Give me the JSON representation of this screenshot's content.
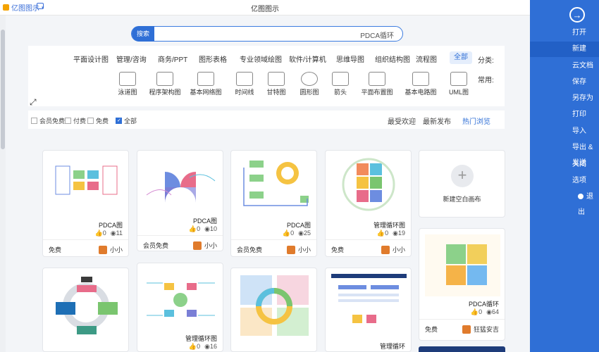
{
  "titlebar": {
    "app_name": "亿图图示",
    "window_title": "亿图图示"
  },
  "nav": {
    "items": [
      {
        "label": "打开"
      },
      {
        "label": "新建"
      },
      {
        "label": "云文档"
      },
      {
        "label": "保存"
      },
      {
        "label": "另存为"
      },
      {
        "label": "打印"
      },
      {
        "label": "导入"
      },
      {
        "label": "导出 & 发送"
      },
      {
        "label": "关闭"
      },
      {
        "label": "选项"
      },
      {
        "label": "退出"
      }
    ]
  },
  "search": {
    "button": "搜索",
    "value": "PDCA循环"
  },
  "categories": {
    "label": "分类:",
    "items": [
      "全部",
      "流程图",
      "组织结构图",
      "思维导图",
      "软件/计算机",
      "专业领域绘图",
      "图形表格",
      "商务/PPT",
      "管理/咨询",
      "平面设计图"
    ],
    "common_label": "常用:",
    "common": [
      "UML图",
      "基本电路图",
      "平面布置图",
      "箭头",
      "圆形图",
      "甘特图",
      "时间线",
      "基本网络图",
      "程序架构图",
      "泳道图"
    ]
  },
  "filters": {
    "tabs": [
      "热门浏览",
      "最新发布",
      "最受欢迎"
    ],
    "checks": [
      {
        "label": "全部",
        "checked": true
      },
      {
        "label": "免费",
        "checked": false
      },
      {
        "label": "付费",
        "checked": false
      },
      {
        "label": "会员免费",
        "checked": false
      }
    ]
  },
  "new_blank": {
    "label": "新建空白画布"
  },
  "cards": [
    {
      "name": "PDCA循环",
      "views": "64",
      "likes": "0",
      "author": "狂猛安吉",
      "price": "免费"
    },
    {
      "name": "管理循环图",
      "views": "19",
      "likes": "0",
      "author": "小小",
      "price": "免费"
    },
    {
      "name": "PDCA图",
      "views": "25",
      "likes": "0",
      "author": "小小",
      "price": "会员免费"
    },
    {
      "name": "PDCA图",
      "views": "10",
      "likes": "0",
      "author": "小小",
      "price": "会员免费"
    },
    {
      "name": "PDCA图",
      "views": "11",
      "likes": "0",
      "author": "小小",
      "price": "免费"
    },
    {
      "name": "管理循环",
      "views": "",
      "likes": "",
      "author": "",
      "price": ""
    },
    {
      "name": "",
      "views": "",
      "likes": "",
      "author": "",
      "price": ""
    },
    {
      "name": "管理循环图",
      "views": "16",
      "likes": "0",
      "author": "",
      "price": ""
    },
    {
      "name": "",
      "views": "",
      "likes": "",
      "author": "",
      "price": ""
    }
  ]
}
